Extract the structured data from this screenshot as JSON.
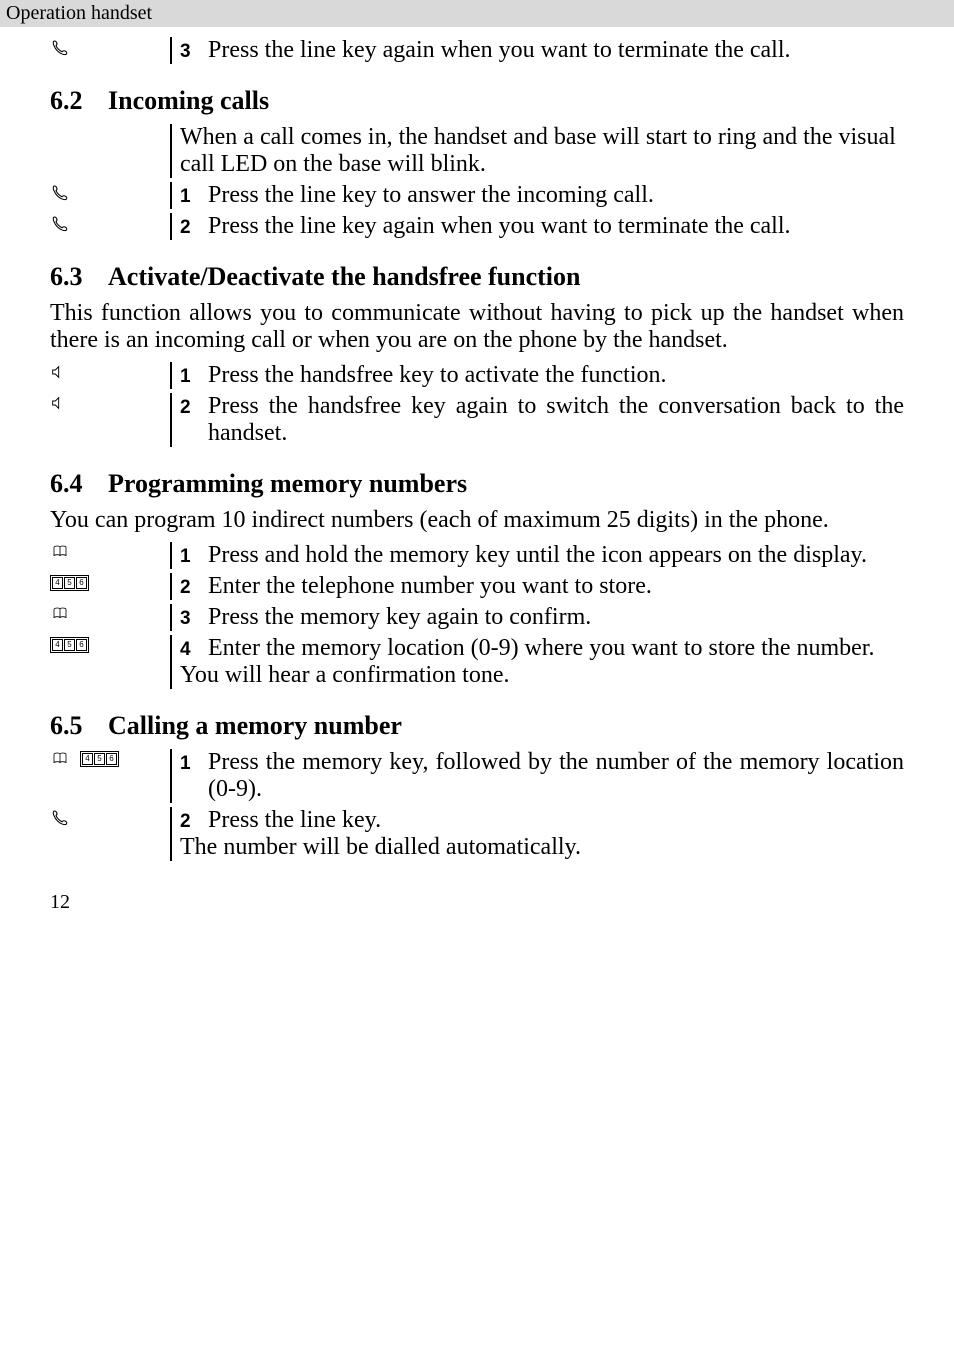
{
  "header": "Operation handset",
  "s61_step3": {
    "num": "3",
    "text": "Press the line key again when you want to terminate the call."
  },
  "s62": {
    "num": "6.2",
    "title": "Incoming calls",
    "intro": "When a call comes in, the handset and base will start to ring and the visual call LED on the base will blink.",
    "step1": {
      "num": "1",
      "text": "Press the line key to answer the incoming call."
    },
    "step2": {
      "num": "2",
      "text": "Press the line key again when you want to terminate the call."
    }
  },
  "s63": {
    "num": "6.3",
    "title": "Activate/Deactivate the handsfree function",
    "intro": "This function allows you to communicate without having to pick up the handset when there is an incoming call or when you are on the phone by the handset.",
    "step1": {
      "num": "1",
      "text": "Press the handsfree key to activate the function."
    },
    "step2": {
      "num": "2",
      "text": "Press the handsfree key again to switch the conversation back to the handset."
    }
  },
  "s64": {
    "num": "6.4",
    "title": "Programming memory numbers",
    "intro": "You can program 10 indirect numbers (each of maximum 25 digits) in the phone.",
    "step1": {
      "num": "1",
      "text": "Press and hold the memory key until the icon appears on the display."
    },
    "step2": {
      "num": "2",
      "text": "Enter the telephone number you want to store."
    },
    "step3": {
      "num": "3",
      "text": "Press the memory key again to confirm."
    },
    "step4": {
      "num": "4",
      "text": "Enter the memory location (0-9) where you want to store the number."
    },
    "outro": "You will hear a confirmation tone."
  },
  "s65": {
    "num": "6.5",
    "title": "Calling a memory number",
    "step1": {
      "num": "1",
      "text": "Press the memory key, followed by the number of the memory location (0-9)."
    },
    "step2": {
      "num": "2",
      "text": "Press the line key."
    },
    "outro": "The number will be dialled automatically."
  },
  "pageNum": "12"
}
